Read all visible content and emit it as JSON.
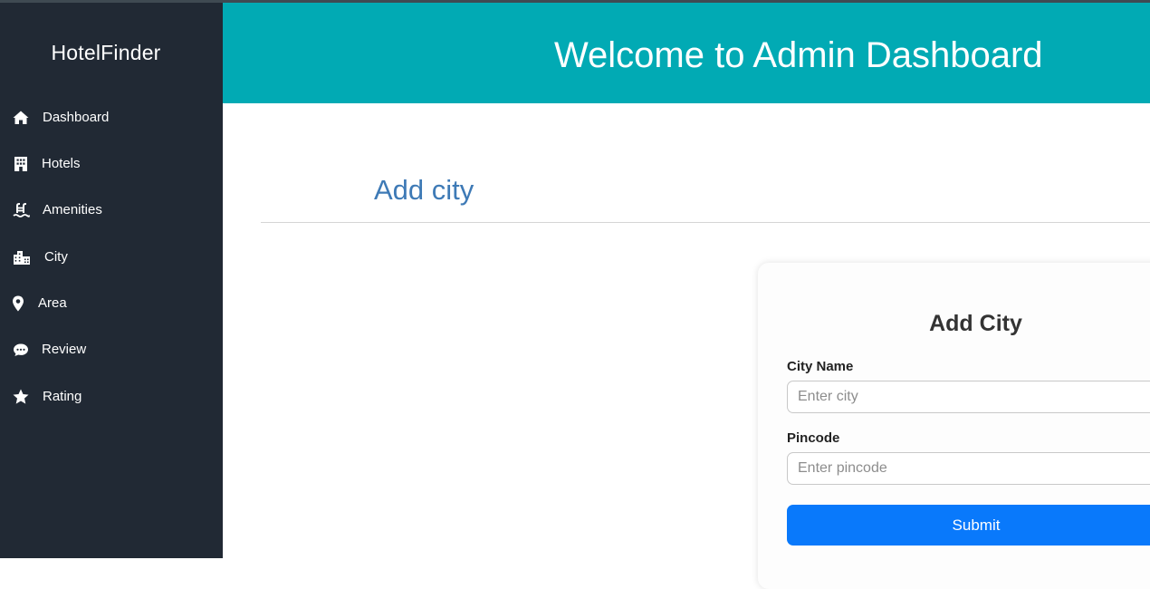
{
  "sidebar": {
    "brand": "HotelFinder",
    "items": [
      {
        "label": "Dashboard",
        "icon": "home-icon"
      },
      {
        "label": "Hotels",
        "icon": "hotel-building-icon"
      },
      {
        "label": "Amenities",
        "icon": "swimming-pool-icon"
      },
      {
        "label": "City",
        "icon": "city-icon"
      },
      {
        "label": "Area",
        "icon": "map-pin-icon"
      },
      {
        "label": "Review",
        "icon": "comment-icon"
      },
      {
        "label": "Rating",
        "icon": "star-icon"
      }
    ]
  },
  "header": {
    "title": "Welcome to Admin Dashboard"
  },
  "main": {
    "section_title": "Add city",
    "form": {
      "title": "Add City",
      "city_label": "City Name",
      "city_placeholder": "Enter city",
      "city_value": "",
      "pincode_label": "Pincode",
      "pincode_placeholder": "Enter pincode",
      "pincode_value": "",
      "submit_label": "Submit"
    }
  },
  "colors": {
    "sidebar_bg": "#212934",
    "header_bg": "#01aab4",
    "section_title": "#3e7ab6",
    "primary_button": "#0979fb"
  }
}
